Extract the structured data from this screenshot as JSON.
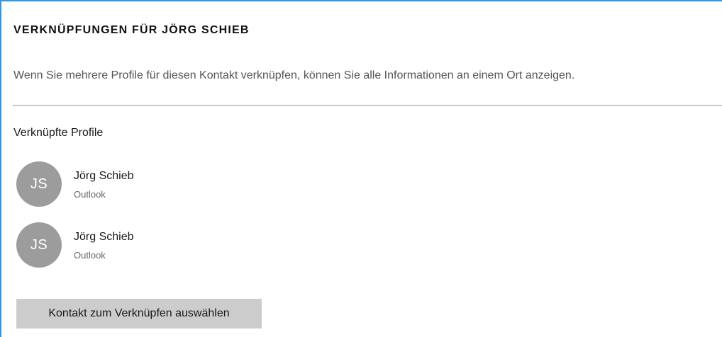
{
  "panel": {
    "title": "VERKNÜPFUNGEN FÜR JÖRG SCHIEB",
    "description": "Wenn Sie mehrere Profile für diesen Kontakt verknüpfen, können Sie alle Informationen an einem Ort anzeigen.",
    "section_label": "Verknüpfte Profile",
    "profiles": [
      {
        "initials": "JS",
        "name": "Jörg Schieb",
        "source": "Outlook"
      },
      {
        "initials": "JS",
        "name": "Jörg Schieb",
        "source": "Outlook"
      }
    ],
    "select_button_label": "Kontakt zum Verknüpfen auswählen"
  },
  "colors": {
    "accent_border": "#4a90c8",
    "avatar": "#9c9c9c",
    "button": "#cccccc",
    "divider": "#c8c8c8"
  }
}
